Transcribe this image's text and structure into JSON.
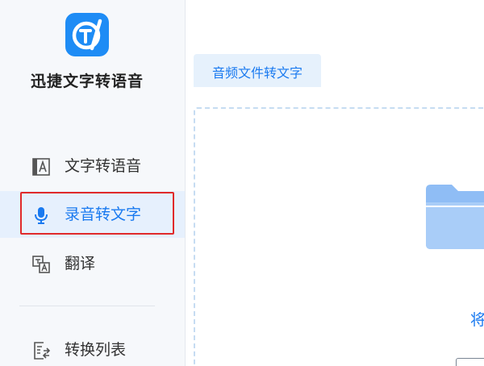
{
  "app": {
    "title": "迅捷文字转语音"
  },
  "sidebar": {
    "items": [
      {
        "label": "文字转语音",
        "icon": "text-a-icon",
        "active": false
      },
      {
        "label": "录音转文字",
        "icon": "microphone-icon",
        "active": true
      },
      {
        "label": "翻译",
        "icon": "translate-icon",
        "active": false
      },
      {
        "label": "转换列表",
        "icon": "conversion-list-icon",
        "active": false
      }
    ]
  },
  "main": {
    "tabs": [
      {
        "label": "音频文件转文字",
        "active": true
      }
    ],
    "drop_zone": {
      "icon": "folder-icon",
      "hint": "将"
    }
  },
  "colors": {
    "accent": "#1a7af0",
    "logo": "#1e8cf5",
    "highlight": "#e02a2a",
    "sidebar_bg": "#f6f8fb",
    "active_bg": "#e6f0fd"
  }
}
